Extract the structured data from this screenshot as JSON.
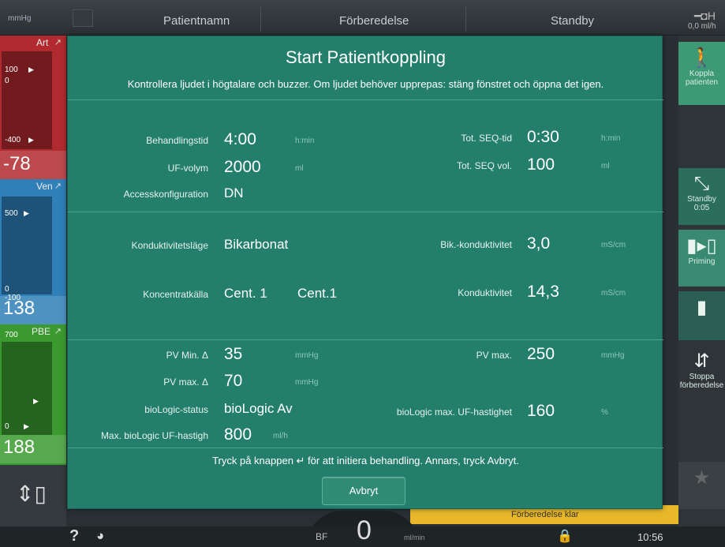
{
  "topbar": {
    "unit": "mmHg",
    "patient_name": "Patientnamn",
    "phase": "Förberedelse",
    "status": "Standby",
    "rate": "0,0  ml/h"
  },
  "pressures": {
    "art": {
      "label": "Art",
      "max": "100",
      "zero": "0",
      "min": "-400",
      "value": "-78"
    },
    "ven": {
      "label": "Ven",
      "max": "500",
      "zero": "0",
      "min": "-100",
      "value": "138"
    },
    "pbe": {
      "label": "PBE",
      "max": "700",
      "zero": "0",
      "value": "188"
    }
  },
  "right_panel": {
    "connect_label": "Koppla patienten",
    "standby_label": "Standby",
    "standby_time": "0:05",
    "priming_label": "Priming",
    "stop_label": "Stoppa förberedelse"
  },
  "dialog": {
    "title": "Start Patientkoppling",
    "info": "Kontrollera ljudet i högtalare och buzzer. Om ljudet behöver upprepas: stäng fönstret och öppna det igen.",
    "rows": {
      "behandlingstid": {
        "label": "Behandlingstid",
        "value": "4:00",
        "unit": "h:min"
      },
      "seq_tid": {
        "label": "Tot. SEQ-tid",
        "value": "0:30",
        "unit": "h:min"
      },
      "uf_volym": {
        "label": "UF-volym",
        "value": "2000",
        "unit": "ml"
      },
      "seq_vol": {
        "label": "Tot. SEQ vol.",
        "value": "100",
        "unit": "ml"
      },
      "access": {
        "label": "Accesskonfiguration",
        "value": "DN"
      },
      "kond_lage": {
        "label": "Konduktivitetsläge",
        "value": "Bikarbonat"
      },
      "bik_kond": {
        "label": "Bik.-konduktivitet",
        "value": "3,0",
        "unit": "mS/cm"
      },
      "konc_kalla": {
        "label": "Koncentratkälla",
        "value1": "Cent. 1",
        "value2": "Cent.1"
      },
      "kond": {
        "label": "Konduktivitet",
        "value": "14,3",
        "unit": "mS/cm"
      },
      "pv_min": {
        "label": "PV Min. Δ",
        "value": "35",
        "unit": "mmHg"
      },
      "pv_max": {
        "label": "PV max.",
        "value": "250",
        "unit": "mmHg"
      },
      "pv_max_d": {
        "label": "PV max. Δ",
        "value": "70",
        "unit": "mmHg"
      },
      "biologic_status": {
        "label": "bioLogic-status",
        "value": "bioLogic Av"
      },
      "biologic_max_uf": {
        "label": "bioLogic max. UF-hastighet",
        "value": "160",
        "unit": "%"
      },
      "max_biologic_uf": {
        "label": "Max. bioLogic UF-hastigh",
        "value": "800",
        "unit": "ml/h"
      }
    },
    "footer": "Tryck på knappen ↵  för att initiera behandling. Annars, tryck Avbryt.",
    "cancel_label": "Avbryt"
  },
  "yellow_status": "Förberedelse klar",
  "bottombar": {
    "help": "?",
    "bf_label": "BF",
    "bf_value": "0",
    "bf_unit": "ml/min",
    "time": "10:56"
  }
}
